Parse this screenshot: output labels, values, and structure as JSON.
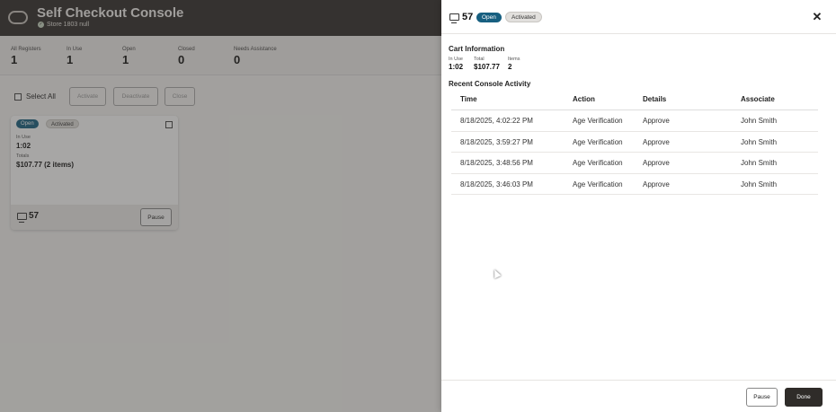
{
  "app": {
    "title": "Self Checkout Console",
    "store": "Store 1803 null"
  },
  "stats": [
    {
      "label": "All Registers",
      "value": "1"
    },
    {
      "label": "In Use",
      "value": "1"
    },
    {
      "label": "Open",
      "value": "1"
    },
    {
      "label": "Closed",
      "value": "0"
    },
    {
      "label": "Needs Assistance",
      "value": "0"
    }
  ],
  "toolbar": {
    "select_all": "Select All",
    "activate": "Activate",
    "deactivate": "Deactivate",
    "close": "Close"
  },
  "register_card": {
    "status_open": "Open",
    "status_activated": "Activated",
    "in_use_label": "In Use",
    "in_use_value": "1:02",
    "totals_label": "Totals",
    "totals_value": "$107.77 (2 items)",
    "register_number": "57",
    "pause": "Pause"
  },
  "drawer": {
    "register_number": "57",
    "status_open": "Open",
    "status_activated": "Activated",
    "close_icon": "close-icon",
    "cart_title": "Cart Information",
    "cart": {
      "in_use_label": "In Use",
      "in_use_value": "1:02",
      "total_label": "Total",
      "total_value": "$107.77",
      "items_label": "Items",
      "items_value": "2"
    },
    "activity_title": "Recent Console Activity",
    "columns": [
      "Time",
      "Action",
      "Details",
      "Associate"
    ],
    "rows": [
      [
        "8/18/2025, 4:02:22 PM",
        "Age Verification",
        "Approve",
        "John Smith"
      ],
      [
        "8/18/2025, 3:59:27 PM",
        "Age Verification",
        "Approve",
        "John Smith"
      ],
      [
        "8/18/2025, 3:48:56 PM",
        "Age Verification",
        "Approve",
        "John Smith"
      ],
      [
        "8/18/2025, 3:46:03 PM",
        "Age Verification",
        "Approve",
        "John Smith"
      ]
    ],
    "pause": "Pause",
    "done": "Done"
  },
  "colors": {
    "header_bg": "#312d2a",
    "open_pill": "#175f80",
    "done_button": "#2f2c29"
  }
}
